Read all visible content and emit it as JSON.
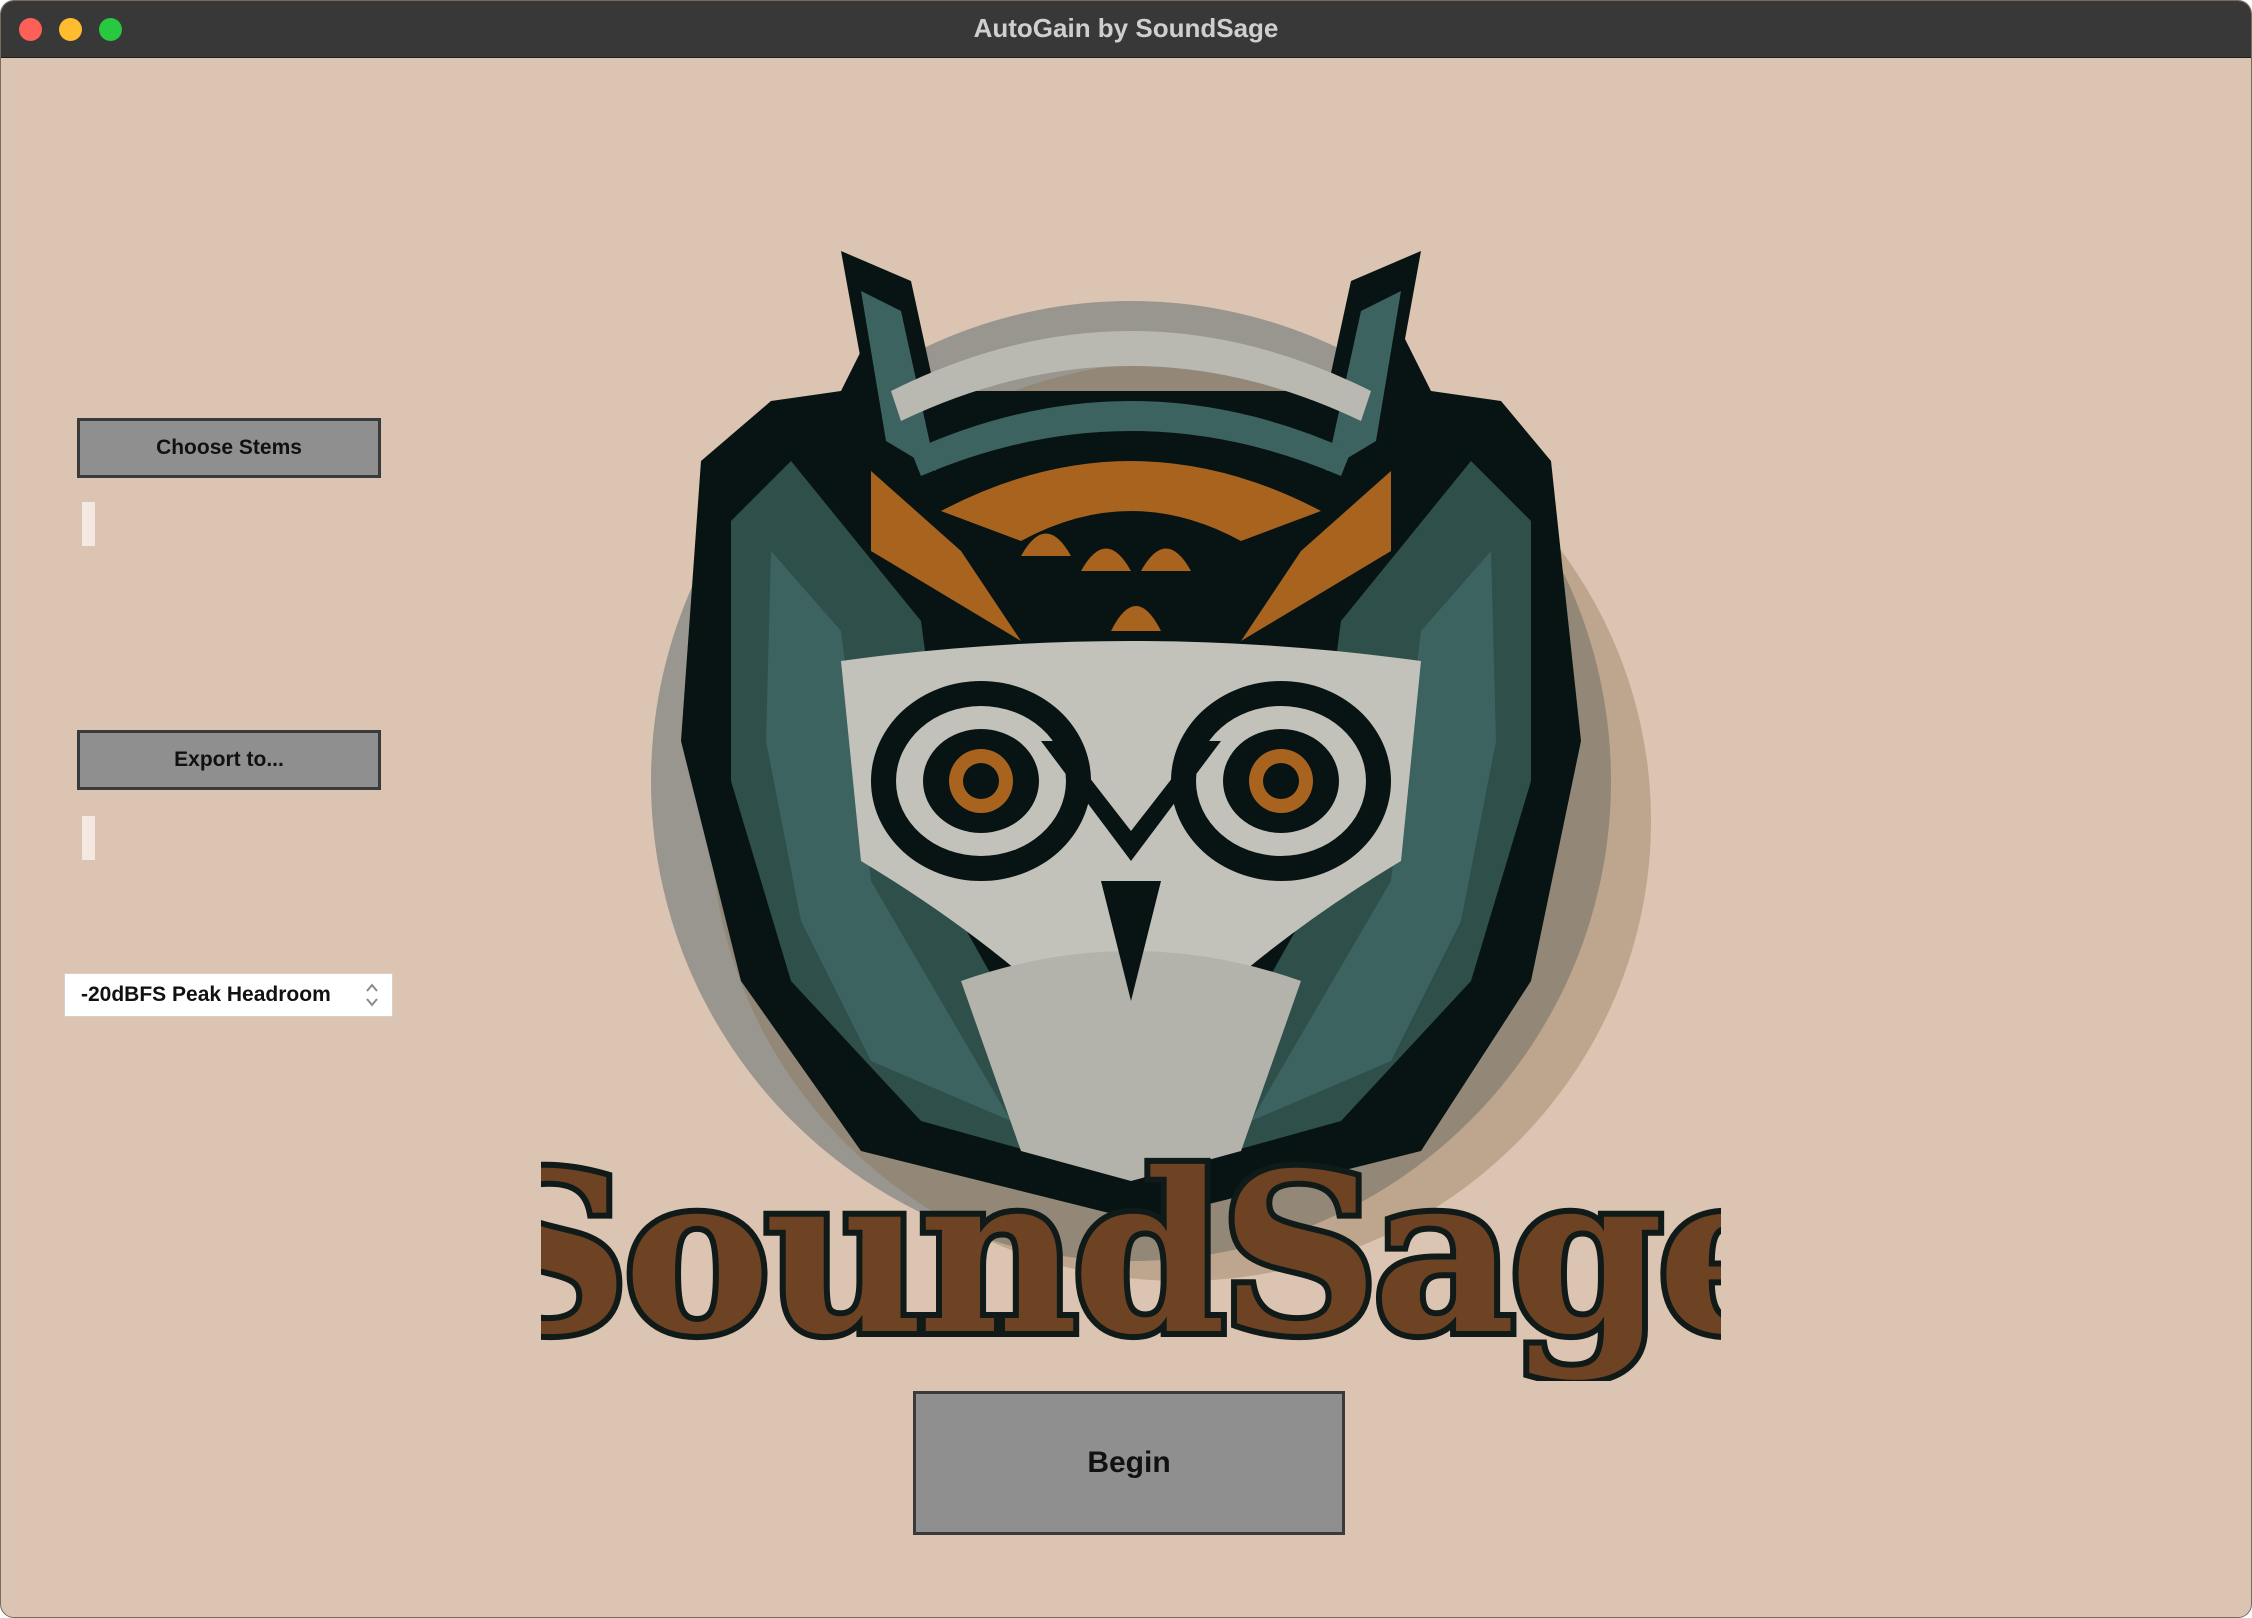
{
  "window": {
    "title": "AutoGain by SoundSage"
  },
  "controls": {
    "choose_stems_label": "Choose Stems",
    "stems_path": "",
    "export_label": "Export to...",
    "export_path": "",
    "headroom_selected": "-20dBFS Peak Headroom",
    "begin_label": "Begin"
  },
  "logo": {
    "wordmark": "SoundSage",
    "icon": "owl-logo",
    "colors": {
      "teal": "#2f4f4b",
      "dark": "#071413",
      "brown": "#7a4a20",
      "orange": "#a8631f",
      "gray": "#8c8e88",
      "pale": "#b9b9b2"
    }
  }
}
